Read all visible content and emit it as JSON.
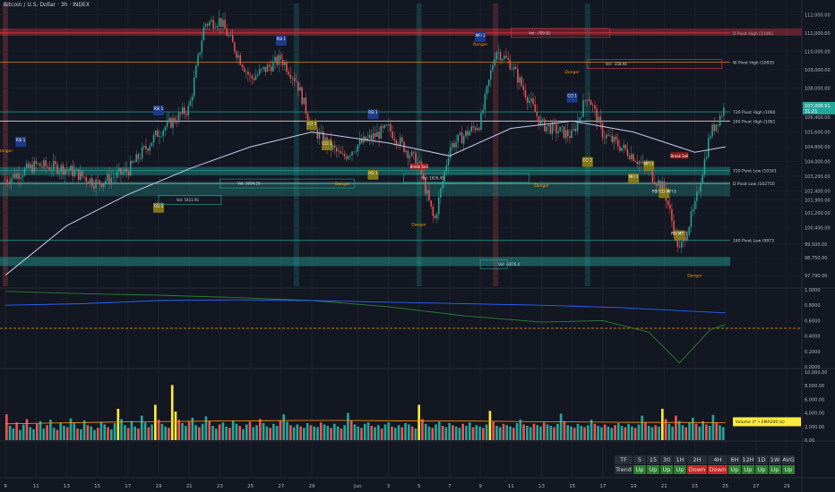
{
  "header": {
    "title": "Bitcoin / U.S. Dollar · 3h · INDEX"
  },
  "colors": {
    "bg": "#131722",
    "up": "#26a69a",
    "down": "#ef5350",
    "accent": "#2962ff",
    "yellow": "#ffeb3b",
    "pivot_red": "#f23645",
    "orange": "#ff9800"
  },
  "chart_data": [
    {
      "type": "line",
      "panel": "price",
      "title": "",
      "xlabel": "",
      "ylabel": "",
      "ylim": [
        97200,
        112600
      ],
      "x_ticks": [
        "9",
        "11",
        "13",
        "15",
        "17",
        "19",
        "21",
        "23",
        "25",
        "27",
        "29",
        "Jun",
        "3",
        "5",
        "7",
        "9",
        "11",
        "13",
        "15",
        "17",
        "19",
        "21",
        "23",
        "25",
        "27",
        "29"
      ],
      "y_ticks": [
        "112,000.00",
        "111,000.00",
        "110,000.00",
        "109,000.00",
        "108,000.00",
        "106,400.00",
        "105,600.00",
        "104,800.00",
        "104,000.00",
        "103,200.00",
        "102,400.00",
        "101,900.00",
        "101,200.00",
        "100,400.00",
        "99,500.00",
        "98,750.00",
        "97,790.00"
      ],
      "price_label": "107,006.51",
      "countdown_label": "31:21",
      "series": [
        {
          "x": [
            "May 9",
            "May 11",
            "May 13",
            "May 15",
            "May 17",
            "May 19",
            "May 21",
            "May 22",
            "May 23",
            "May 25",
            "May 27",
            "May 28",
            "May 29",
            "May 31",
            "Jun 1",
            "Jun 3",
            "Jun 5",
            "Jun 6",
            "Jun 7",
            "Jun 9",
            "Jun 10",
            "Jun 11",
            "Jun 13",
            "Jun 15",
            "Jun 16",
            "Jun 17",
            "Jun 19",
            "Jun 21",
            "Jun 22",
            "Jun 23",
            "Jun 24",
            "Jun 25"
          ],
          "values": [
            103000,
            103800,
            103600,
            102800,
            103500,
            105600,
            106900,
            111500,
            111700,
            108500,
            109600,
            108400,
            105800,
            104200,
            104900,
            105800,
            103800,
            100700,
            104800,
            106100,
            110100,
            109300,
            106000,
            105400,
            107700,
            105500,
            104300,
            102500,
            99100,
            101500,
            105500,
            107000
          ]
        },
        {
          "name": "",
          "x": [
            "May 9",
            "May 13",
            "May 17",
            "May 21",
            "May 25",
            "May 29",
            "Jun 3",
            "Jun 7",
            "Jun 11",
            "Jun 15",
            "Jun 19",
            "Jun 23",
            "Jun 25"
          ],
          "values": [
            97800,
            100500,
            102200,
            103600,
            104800,
            105600,
            105000,
            104300,
            105800,
            106200,
            105600,
            104500,
            104800
          ]
        }
      ],
      "levels": [
        {
          "label": "D Pivot High (11061",
          "value": 111000,
          "color": "#f23645"
        },
        {
          "label": "W Pivot High (10935",
          "value": 109400,
          "color": "#ff9800"
        },
        {
          "label": "720 Pivot High (1060",
          "value": 106700,
          "color": "#26a69a"
        },
        {
          "label": "240 Pivot High (1061",
          "value": 106200,
          "color": "#ffffff"
        },
        {
          "label": "720 Pivot Low (10341",
          "value": 103500,
          "color": "#26a69a"
        },
        {
          "label": "D Pivot Low (102750",
          "value": 102800,
          "color": "#ffffff"
        },
        {
          "label": "240 Pivot Low (9973",
          "value": 99700,
          "color": "#26a69a"
        }
      ],
      "annotations": [
        "RSI 1",
        "RSI 1",
        "RSI 1",
        "RSI 1",
        "CCI 1",
        "CCI 1",
        "CCI 1",
        "CCI 1",
        "MFI 1",
        "MFI 1",
        "RSI MFI 2",
        "RSI 1",
        "MFI 1",
        "RSI CCI MFI 3",
        "CCI 1",
        "Danger",
        "Danger",
        "Danger",
        "Danger",
        "Danger",
        "Danger",
        "Danger",
        "Break Sell",
        "Break Sell",
        "Vol: -709.81",
        "Vol: -358.94",
        "Vol: 3004.25",
        "Vol: 5411.91",
        "Vol: 1626.45",
        "Vol: -3076.4"
      ]
    },
    {
      "type": "line",
      "panel": "oscillator",
      "title": "",
      "xlabel": "",
      "ylabel": "",
      "ylim": [
        0,
        1
      ],
      "y_ticks": [
        "1.0000",
        "0.8000",
        "0.6000",
        "0.4000",
        "0.2000",
        "0.0000"
      ],
      "series": [
        {
          "x": [
            "May 9",
            "May 14",
            "May 19",
            "May 24",
            "May 29",
            "Jun 3",
            "Jun 8",
            "Jun 13",
            "Jun 17",
            "Jun 20",
            "Jun 22",
            "Jun 24",
            "Jun 25"
          ],
          "values": [
            0.98,
            0.95,
            0.93,
            0.9,
            0.86,
            0.78,
            0.66,
            0.58,
            0.6,
            0.45,
            0.05,
            0.48,
            0.55
          ]
        },
        {
          "x": [
            "May 9",
            "May 14",
            "May 19",
            "May 24",
            "May 29",
            "Jun 3",
            "Jun 8",
            "Jun 13",
            "Jun 18",
            "Jun 25"
          ],
          "values": [
            0.8,
            0.82,
            0.86,
            0.87,
            0.86,
            0.84,
            0.82,
            0.8,
            0.77,
            0.7
          ]
        }
      ],
      "reference_line": 0.5
    },
    {
      "type": "bar",
      "panel": "volume",
      "title": "",
      "xlabel": "",
      "ylabel": "",
      "ylim": [
        0,
        10000
      ],
      "y_ticks": [
        "10,000.00",
        "8,000.00",
        "6,000.00",
        "4,000.00",
        "2,000.00",
        "0.00"
      ],
      "legend": "Volume 3* • EMA200 (x)",
      "values": [
        3800,
        2100,
        1700,
        2600,
        1500,
        2300,
        3100,
        1900,
        1600,
        2400,
        2800,
        1700,
        2200,
        3000,
        1800,
        1500,
        2600,
        2100,
        1900,
        3200,
        2500,
        1700,
        1600,
        2900,
        2200,
        2000,
        1500,
        1800,
        2700,
        2300,
        1900,
        1600,
        2500,
        4600,
        3100,
        2200,
        1800,
        2800,
        2000,
        1700,
        3600,
        2600,
        1900,
        2300,
        5200,
        3000,
        2400,
        2000,
        1800,
        8100,
        4200,
        3000,
        2500,
        2100,
        2700,
        3300,
        2200,
        1900,
        2400,
        3500,
        2800,
        2100,
        1700,
        2300,
        2600,
        2000,
        1800,
        2900,
        2400,
        2100,
        1600,
        2300,
        2700,
        1900,
        2200,
        3100,
        2500,
        2000,
        1800,
        2400,
        2100,
        2900,
        3800,
        2700,
        2200,
        1900,
        2300,
        2000,
        1800,
        2500,
        2200,
        2000,
        1900,
        2600,
        2300,
        2100,
        1800,
        2400,
        2000,
        1700,
        2200,
        4000,
        2900,
        2300,
        2000,
        1800,
        2400,
        2600,
        2100,
        1900,
        2200,
        1700,
        2300,
        2600,
        2000,
        1800,
        2200,
        1900,
        2500,
        2300,
        2000,
        1700,
        5200,
        3100,
        2400,
        2000,
        1800,
        2300,
        2700,
        2100,
        1900,
        2500,
        2200,
        2000,
        1800,
        2400,
        2100,
        2600,
        1900,
        2200,
        2000,
        1800,
        2300,
        4300,
        2700,
        2100,
        1900,
        2400,
        2200,
        2000,
        1800,
        2500,
        3000,
        2300,
        2100,
        1900,
        2400,
        2200,
        2000,
        2600,
        2300,
        2100,
        1900,
        2400,
        3900,
        2800,
        2200,
        2000,
        1800,
        2400,
        2100,
        1900,
        2200,
        3000,
        2400,
        2100,
        1900,
        2300,
        2000,
        1800,
        2200,
        2500,
        2100,
        1900,
        2400,
        2000,
        1800,
        2300,
        3600,
        2600,
        2100,
        1900,
        2200,
        2000,
        4600,
        3100,
        2400,
        2000,
        3600,
        2800,
        2200,
        1900,
        2600,
        3300,
        2400,
        2000,
        2800,
        2300,
        2100,
        3700,
        2600,
        2200,
        1900
      ],
      "ema": [
        2400,
        2500,
        2600,
        2700,
        2750,
        2800,
        2850,
        2900,
        2900,
        2850,
        2800,
        2800,
        2750,
        2700,
        2650,
        2600,
        2600,
        2550
      ]
    }
  ],
  "trend_table": {
    "header": [
      "TF",
      "5",
      "15",
      "30",
      "1H",
      "2H",
      "4H",
      "6H",
      "12H",
      "1D",
      "1W",
      "AVG"
    ],
    "row_label": "Trend",
    "values": [
      "Up",
      "Up",
      "Up",
      "Up",
      "Down",
      "Down",
      "Up",
      "Up",
      "Up",
      "Up",
      "Up"
    ]
  }
}
